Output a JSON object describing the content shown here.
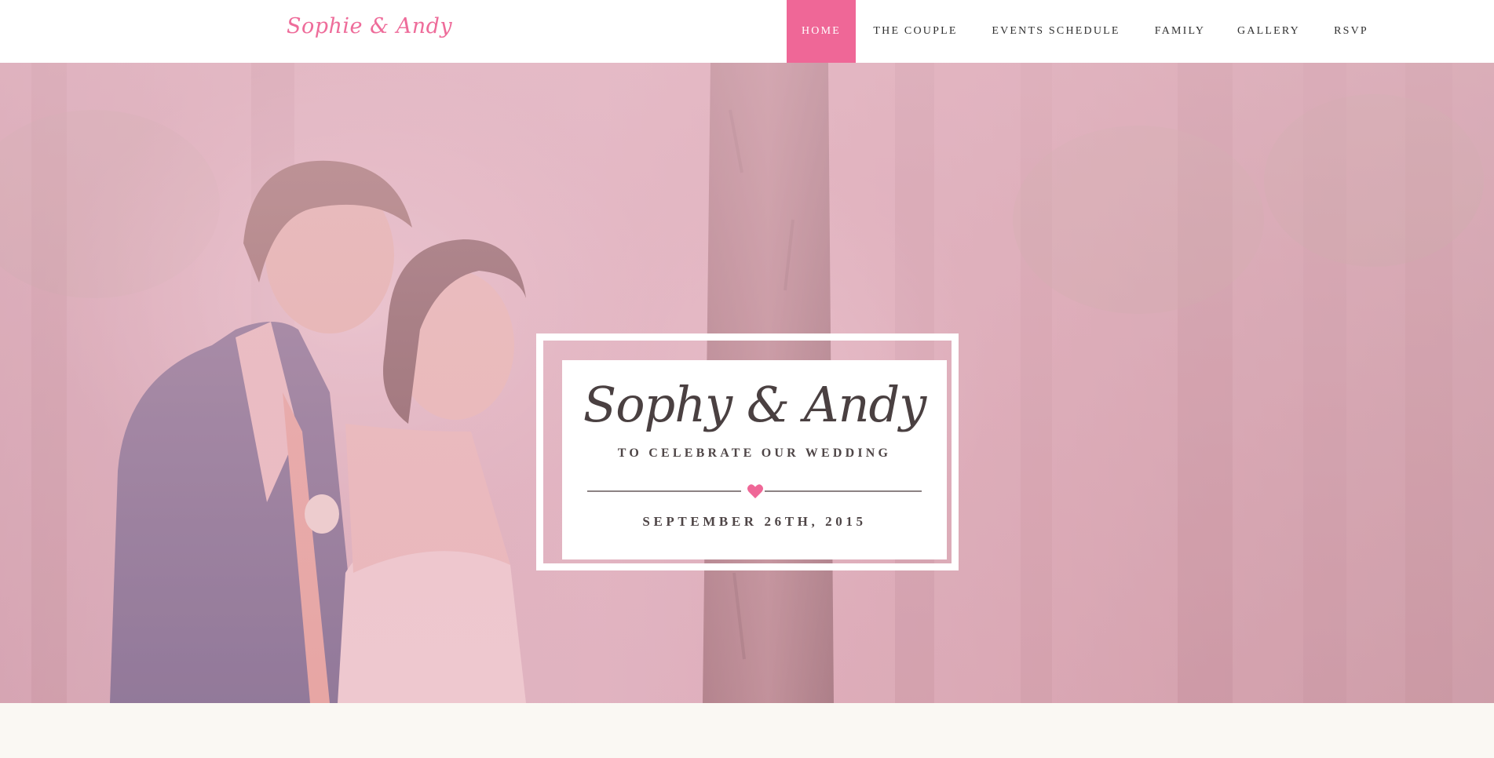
{
  "header": {
    "logo": "Sophie & Andy",
    "nav": [
      {
        "label": "HOME",
        "active": true
      },
      {
        "label": "THE COUPLE",
        "active": false
      },
      {
        "label": "EVENTS SCHEDULE",
        "active": false
      },
      {
        "label": "FAMILY",
        "active": false
      },
      {
        "label": "GALLERY",
        "active": false
      },
      {
        "label": "RSVP",
        "active": false
      }
    ]
  },
  "hero": {
    "names": "Sophy & Andy",
    "subtitle": "TO CELEBRATE OUR WEDDING",
    "date": "SEPTEMBER 26TH, 2015",
    "divider_icon": "heart-icon"
  },
  "colors": {
    "accent": "#ef6797",
    "logo": "#ee6c9a",
    "text": "#4e4546",
    "page_bg": "#faf8f3"
  }
}
